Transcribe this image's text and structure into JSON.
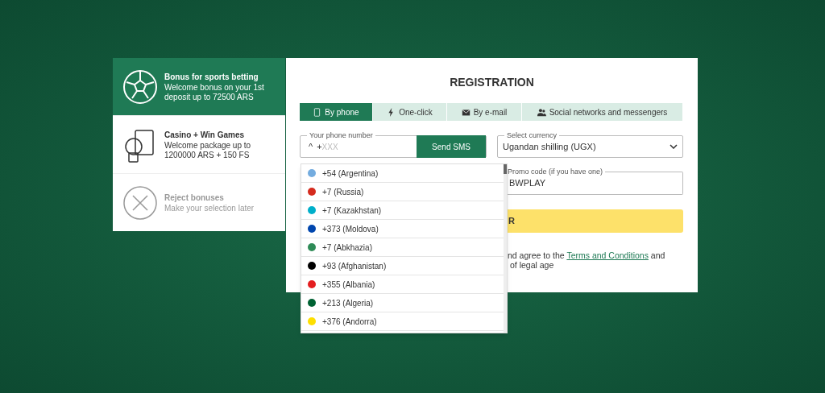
{
  "bonuses": [
    {
      "kind": "sports",
      "title": "Bonus for sports betting",
      "text": "Welcome bonus on your 1st deposit up to 72500 ARS",
      "selected": true,
      "disabled": false
    },
    {
      "kind": "casino",
      "title": "Casino + Win Games",
      "text": "Welcome package up to 1200000 ARS + 150 FS",
      "selected": false,
      "disabled": false
    },
    {
      "kind": "reject",
      "title": "Reject bonuses",
      "text": "Make your selection later",
      "selected": false,
      "disabled": true
    }
  ],
  "title": "REGISTRATION",
  "tabs": [
    {
      "kind": "phone",
      "label": "By phone",
      "selected": true
    },
    {
      "kind": "bolt",
      "label": "One-click",
      "selected": false
    },
    {
      "kind": "mail",
      "label": "By e-mail",
      "selected": false
    },
    {
      "kind": "people",
      "label": "Social networks and messengers",
      "selected": false
    }
  ],
  "phone": {
    "label": "Your phone number",
    "caret": "^",
    "prefix": "+",
    "placeholder": "XXX",
    "button": "Send SMS"
  },
  "currency": {
    "label": "Select currency",
    "value": "Ugandan shilling (UGX)"
  },
  "promo": {
    "label": "Promo code (if you have one)",
    "value": "BWPLAY"
  },
  "submit": {
    "label": "R"
  },
  "terms": {
    "before": "nd agree to the ",
    "link": "Terms and Conditions",
    "after": " and",
    "line2": "of legal age"
  },
  "countries": [
    {
      "label": "+54 (Argentina)",
      "color": "#74acdf"
    },
    {
      "label": "+7 (Russia)",
      "color": "#d52b1e"
    },
    {
      "label": "+7 (Kazakhstan)",
      "color": "#00afca"
    },
    {
      "label": "+373 (Moldova)",
      "color": "#0046ae"
    },
    {
      "label": "+7 (Abkhazia)",
      "color": "#2e8b57"
    },
    {
      "label": "+93 (Afghanistan)",
      "color": "#000000"
    },
    {
      "label": "+355 (Albania)",
      "color": "#e41e20"
    },
    {
      "label": "+213 (Algeria)",
      "color": "#006233"
    },
    {
      "label": "+376 (Andorra)",
      "color": "#fedf00"
    }
  ]
}
